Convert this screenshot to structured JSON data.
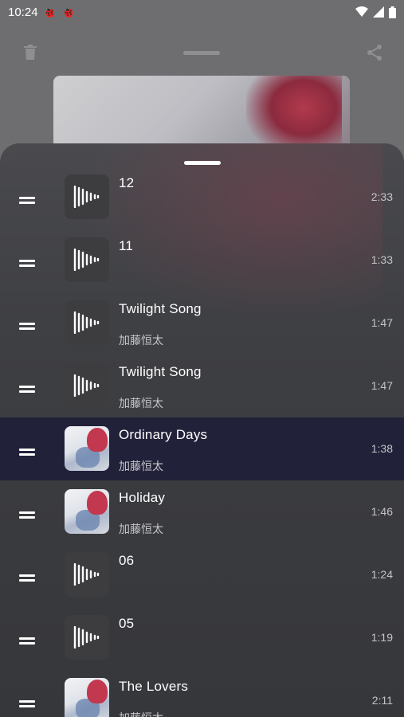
{
  "status_bar": {
    "time": "10:24",
    "notifications": [
      "bug-icon",
      "bug-icon"
    ],
    "right_icons": [
      "wifi-icon",
      "signal-icon",
      "battery-icon"
    ]
  },
  "player": {
    "left_action_icon": "trash-icon",
    "right_action_icon": "share-icon"
  },
  "colors": {
    "sheet_bg": "#3f4044",
    "active_row": "#22213a",
    "text_primary": "#ffffff",
    "text_secondary": "#c6c6c9"
  },
  "queue": {
    "items": [
      {
        "title": "12",
        "artist": "",
        "duration": "2:33",
        "cover": "waveform-icon"
      },
      {
        "title": "11",
        "artist": "",
        "duration": "1:33",
        "cover": "waveform-icon"
      },
      {
        "title": "Twilight Song",
        "artist": "加藤恒太",
        "duration": "1:47",
        "cover": "waveform-icon"
      },
      {
        "title": "Twilight Song",
        "artist": "加藤恒太",
        "duration": "1:47",
        "cover": "waveform-icon"
      },
      {
        "title": "Ordinary Days",
        "artist": "加藤恒太",
        "duration": "1:38",
        "cover": "album-art",
        "active": true
      },
      {
        "title": "Holiday",
        "artist": "加藤恒太",
        "duration": "1:46",
        "cover": "album-art"
      },
      {
        "title": "06",
        "artist": "",
        "duration": "1:24",
        "cover": "waveform-icon"
      },
      {
        "title": "05",
        "artist": "",
        "duration": "1:19",
        "cover": "waveform-icon"
      },
      {
        "title": "The Lovers",
        "artist": "加藤恒太",
        "duration": "2:11",
        "cover": "album-art"
      }
    ]
  }
}
